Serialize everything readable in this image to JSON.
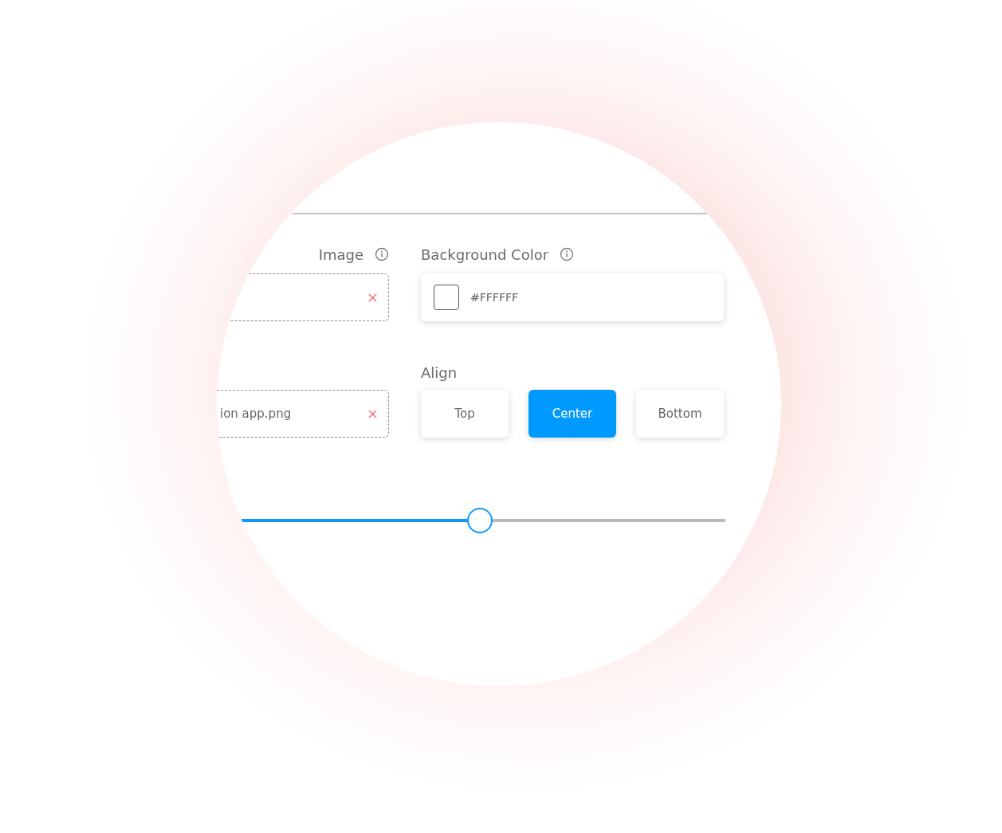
{
  "image": {
    "label": "Image",
    "slots": [
      {
        "kind": "empty"
      },
      {
        "kind": "file",
        "filename": "ion app.png"
      }
    ]
  },
  "background_color": {
    "label": "Background Color",
    "value": "#FFFFFF",
    "color": "#ffffff"
  },
  "align": {
    "label": "Align",
    "options": [
      {
        "label": "Top",
        "selected": false
      },
      {
        "label": "Center",
        "selected": true
      },
      {
        "label": "Bottom",
        "selected": false
      }
    ]
  },
  "slider": {
    "level": 0.5
  }
}
